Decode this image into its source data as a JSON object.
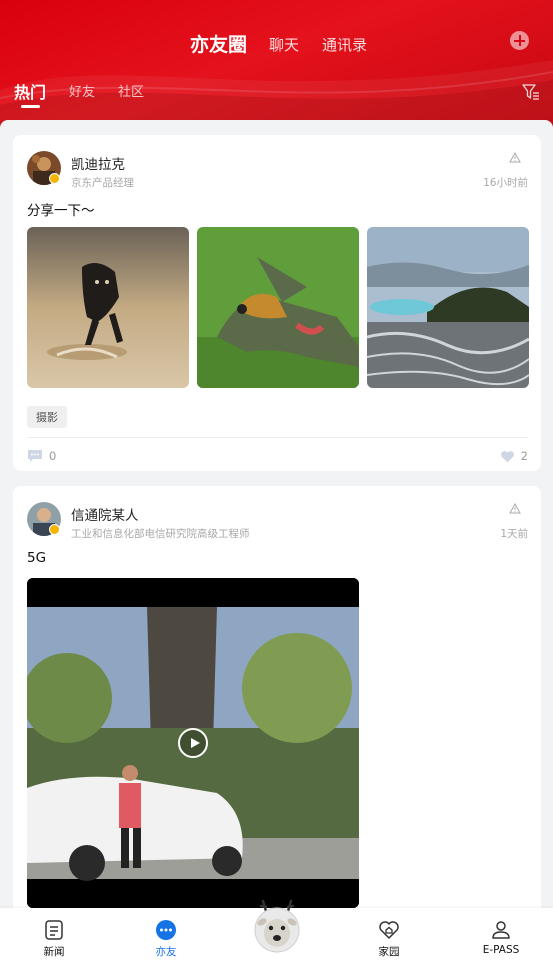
{
  "header": {
    "tabs": [
      {
        "label": "亦友圈",
        "active": true
      },
      {
        "label": "聊天",
        "active": false
      },
      {
        "label": "通讯录",
        "active": false
      }
    ],
    "add_icon": "plus-circle-icon",
    "sub_tabs": [
      {
        "label": "热门",
        "active": true
      },
      {
        "label": "好友",
        "active": false
      },
      {
        "label": "社区",
        "active": false
      }
    ],
    "filter_icon": "filter-icon"
  },
  "posts": [
    {
      "author": "凯迪拉克",
      "title": "京东产品经理",
      "time": "16小时前",
      "text": "分享一下～",
      "images": [
        "running-dog",
        "crocodile-and-bird",
        "glacier-landscape"
      ],
      "tag": "摄影",
      "comments": "0",
      "likes": "2"
    },
    {
      "author": "信通院某人",
      "title": "工业和信息化部电信研究院高级工程师",
      "time": "1天前",
      "text": "5G",
      "media": "video"
    }
  ],
  "bottom_nav": {
    "items": [
      {
        "label": "新闻",
        "icon": "news-icon",
        "active": false
      },
      {
        "label": "亦友",
        "icon": "chat-bubble-icon",
        "active": true
      },
      {
        "label": "家园",
        "icon": "home-heart-icon",
        "active": false
      },
      {
        "label": "E-PASS",
        "icon": "user-icon",
        "active": false
      }
    ],
    "center_icon": "deer-mascot-icon"
  },
  "colors": {
    "brand_red": "#d9000d",
    "active_blue": "#1673e6",
    "badge_gold": "#f5b400"
  }
}
